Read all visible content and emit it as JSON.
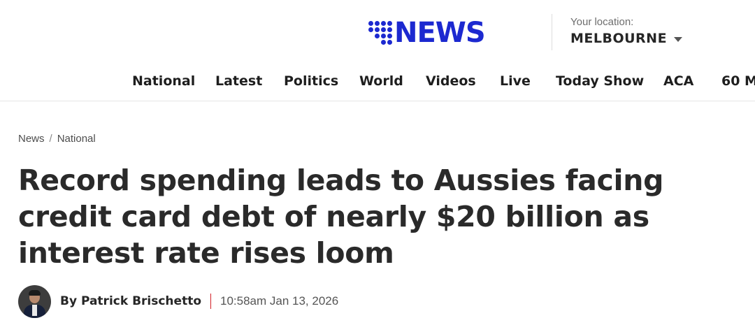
{
  "brand": {
    "logo_text": "NEWS",
    "logo_color": "#1c29d0",
    "logo_aria": "9 NEWS"
  },
  "location": {
    "label": "Your location:",
    "value": "MELBOURNE"
  },
  "nav": {
    "items": [
      {
        "label": "National"
      },
      {
        "label": "Latest"
      },
      {
        "label": "Politics"
      },
      {
        "label": "World"
      },
      {
        "label": "Videos"
      },
      {
        "label": "Live"
      },
      {
        "label": "Today Show"
      },
      {
        "label": "ACA"
      },
      {
        "label": "60 M"
      }
    ]
  },
  "breadcrumb": {
    "items": [
      {
        "label": "News"
      },
      {
        "label": "National"
      }
    ],
    "separator": "/"
  },
  "article": {
    "headline": "Record spending leads to Aussies facing credit card debt of nearly $20 billion as interest rate rises loom",
    "author": "By Patrick Brischetto",
    "timestamp": "10:58am Jan 13, 2026"
  },
  "colors": {
    "accent_blue": "#1c29d0",
    "byline_separator": "#d21f26"
  }
}
